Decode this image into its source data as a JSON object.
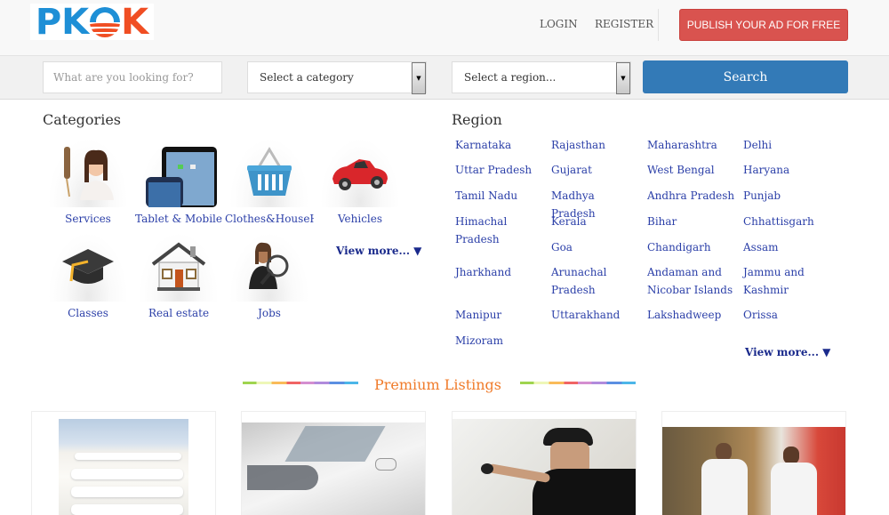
{
  "header": {
    "logo": {
      "part1": "PK",
      "part2": "K"
    },
    "login": "LOGIN",
    "register": "REGISTER",
    "publish": "PUBLISH YOUR AD FOR FREE"
  },
  "search": {
    "placeholder": "What are you looking for?",
    "category_select": "Select a category",
    "region_select": "Select a region...",
    "button": "Search"
  },
  "categories": {
    "title": "Categories",
    "items": [
      {
        "label": "Services",
        "icon": "services-icon"
      },
      {
        "label": "Tablet & Mobile",
        "icon": "tablet-mobile-icon"
      },
      {
        "label": "Clothes&HouseHold",
        "icon": "basket-icon"
      },
      {
        "label": "Vehicles",
        "icon": "car-icon"
      },
      {
        "label": "Classes",
        "icon": "graduation-cap-icon"
      },
      {
        "label": "Real estate",
        "icon": "house-icon"
      },
      {
        "label": "Jobs",
        "icon": "job-search-icon"
      }
    ],
    "view_more": "View more... ▼"
  },
  "region": {
    "title": "Region",
    "items": [
      "Karnataka",
      "Rajasthan",
      "Maharashtra",
      "Delhi",
      "Uttar Pradesh",
      "Gujarat",
      "West Bengal",
      "Haryana",
      "Tamil Nadu",
      "Madhya Pradesh",
      "Andhra Pradesh",
      "Punjab",
      "Himachal Pradesh",
      "Kerala",
      "Bihar",
      "Chhattisgarh",
      "Goa",
      "Chandigarh",
      "Assam",
      "Jharkhand",
      "Arunachal Pradesh",
      "Andaman and Nicobar Islands",
      "Jammu and Kashmir",
      "Manipur",
      "Uttarakhand",
      "Lakshadweep",
      "Orissa",
      "Mizoram"
    ],
    "view_more": "View more... ▼"
  },
  "premium": {
    "title": "Premium Listings",
    "listings": [
      {
        "image": "towels-photo"
      },
      {
        "image": "white-car-photo"
      },
      {
        "image": "cctv-installer-photo"
      },
      {
        "image": "chefs-photo"
      }
    ]
  }
}
